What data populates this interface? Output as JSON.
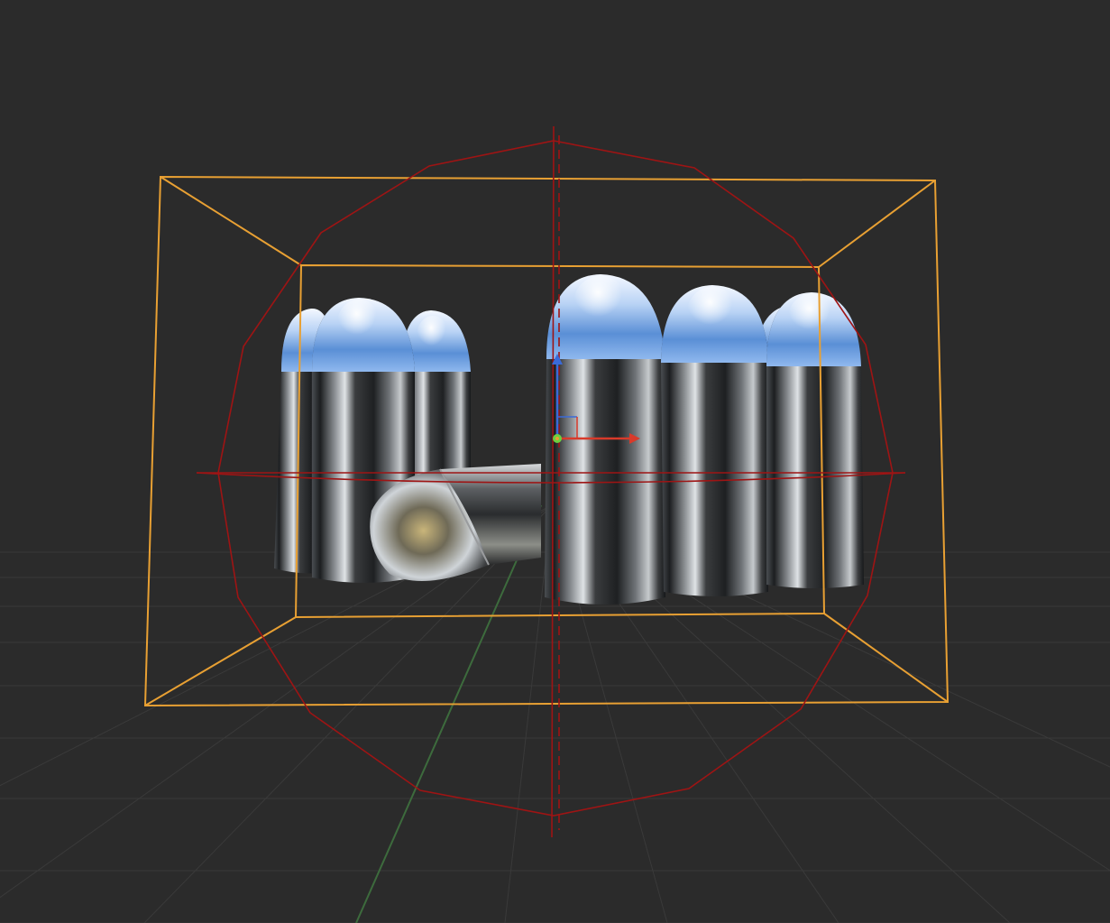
{
  "viewport": {
    "background": "#2b2b2b",
    "grid_color": "#3a3a3a",
    "y_axis_line_color": "#3d6b3d",
    "selection_outline_color": "#e8a033",
    "light_gizmo_color": "#9e1414",
    "object_origin_gizmo": {
      "x_axis_color": "#d83a2a",
      "y_axis_color": "#6bd040",
      "z_axis_color": "#3a6ad8"
    }
  },
  "scene": {
    "objects": [
      {
        "name": "bullet",
        "count": 8,
        "material": "chrome"
      },
      {
        "name": "bullet",
        "orientation": "lying",
        "count": 1,
        "material": "chrome"
      }
    ],
    "selection": "active",
    "light_type": "area-sphere"
  }
}
